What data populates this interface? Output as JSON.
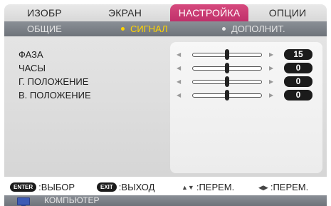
{
  "tabs": [
    {
      "label": "ИЗОБР",
      "active": false
    },
    {
      "label": "ЭКРАН",
      "active": false
    },
    {
      "label": "НАСТРОЙКА",
      "active": true
    },
    {
      "label": "ОПЦИИ",
      "active": false
    }
  ],
  "subtabs": [
    {
      "label": "ОБЩИЕ",
      "active": false
    },
    {
      "label": "СИГНАЛ",
      "active": true
    },
    {
      "label": "ДОПОЛНИТ.",
      "active": false
    }
  ],
  "settings": [
    {
      "label": "ФАЗА",
      "value": "15",
      "level": 0.5
    },
    {
      "label": "ЧАСЫ",
      "value": "0",
      "level": 0.5
    },
    {
      "label": "Г. ПОЛОЖЕНИЕ",
      "value": "0",
      "level": 0.5
    },
    {
      "label": "В. ПОЛОЖЕНИЕ",
      "value": "0",
      "level": 0.5
    }
  ],
  "hints": {
    "enter_key": "ENTER",
    "enter_label": ":ВЫБОР",
    "exit_key": "EXIT",
    "exit_label": ":ВЫХОД",
    "updown_label": ":ПЕРЕМ.",
    "leftright_label": ":ПЕРЕМ."
  },
  "source": {
    "label": "КОМПЬЮТЕР",
    "icon": "monitor-icon"
  },
  "colors": {
    "active_tab": "#c8366f",
    "active_subtab": "#ffd400",
    "value_badge": "#1b1b1b"
  }
}
